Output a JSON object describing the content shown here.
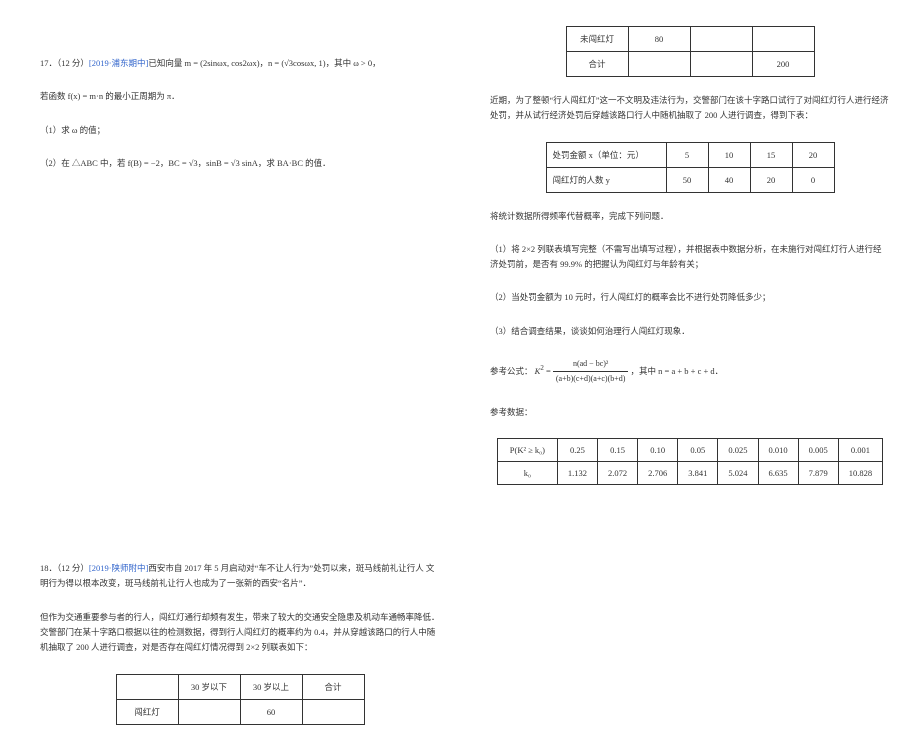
{
  "left": {
    "q17": {
      "header_pre": "17．（12 分）",
      "source": "[2019·浦东期中]",
      "header_post": "已知向量 m = (2sinωx, cos2ωx)，n = (√3cosωx, 1)，其中 ω > 0，",
      "line2": "若函数 f(x) = m·n 的最小正周期为 π．",
      "part1": "（1）求 ω 的值；",
      "part2": "（2）在 △ABC 中，若 f(B) = −2，BC = √3，sinB = √3 sinA，求 BA·BC 的值．"
    },
    "q18": {
      "header_pre": "18．（12 分）",
      "source": "[2019·陕师附中]",
      "header_post": "西安市自 2017 年 5 月启动对“车不让人行为”处罚以来，斑马线前礼让行人",
      "line2": "文明行为得以根本改变，斑马线前礼让行人也成为了一张新的西安“名片”．",
      "para2": "但作为交通重要参与者的行人，闯红灯通行却频有发生，带来了较大的交通安全隐患及机动车通畅率降低．交警部门在某十字路口根据以往的检测数据，得到行人闯红灯的概率约为 0.4，并从穿越该路口的行人中随机抽取了 200 人进行调查，对是否存在闯红灯情况得到 2×2 列联表如下：",
      "table1": {
        "headers": [
          "",
          "30 岁以下",
          "30 岁以上",
          "合计"
        ],
        "rows": [
          [
            "闯红灯",
            "",
            "60",
            ""
          ]
        ]
      }
    }
  },
  "right": {
    "table1_cont": {
      "rows": [
        [
          "未闯红灯",
          "80",
          "",
          ""
        ],
        [
          "合计",
          "",
          "",
          "200"
        ]
      ]
    },
    "para1": "近期，为了整顿“行人闯红灯”这一不文明及违法行为，交警部门在该十字路口试行了对闯红灯行人进行经济处罚，并从试行经济处罚后穿越该路口行人中随机抽取了 200 人进行调查，得到下表：",
    "table2": {
      "rows": [
        [
          "处罚金额 x（单位：元）",
          "5",
          "10",
          "15",
          "20"
        ],
        [
          "闯红灯的人数 y",
          "50",
          "40",
          "20",
          "0"
        ]
      ]
    },
    "para2": "将统计数据所得频率代替概率，完成下列问题．",
    "q1": "（1）将 2×2 列联表填写完整（不需写出填写过程），并根据表中数据分析，在未施行对闯红灯行人进行经济处罚前，是否有 99.9% 的把握认为闯红灯与年龄有关；",
    "q2": "（2）当处罚金额为 10 元时，行人闯红灯的概率会比不进行处罚降低多少；",
    "q3": "（3）结合调查结果，谈谈如何治理行人闯红灯现象．",
    "formula_label": "参考公式：",
    "formula_num": "n(ad − bc)²",
    "formula_den": "(a+b)(c+d)(a+c)(b+d)",
    "formula_where": "，其中 n = a + b + c + d．",
    "ref_data_label": "参考数据：",
    "table3": {
      "headers": [
        "P(K² ≥ k₀)",
        "0.25",
        "0.15",
        "0.10",
        "0.05",
        "0.025",
        "0.010",
        "0.005",
        "0.001"
      ],
      "row": [
        "k₀",
        "1.132",
        "2.072",
        "2.706",
        "3.841",
        "5.024",
        "6.635",
        "7.879",
        "10.828"
      ]
    }
  }
}
